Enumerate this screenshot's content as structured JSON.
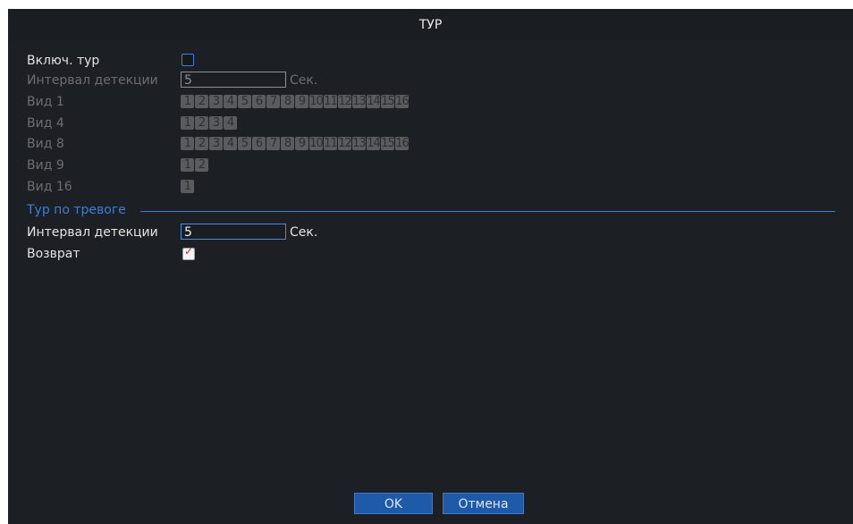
{
  "dialog": {
    "title": "ТУР"
  },
  "enable_tour": {
    "label": "Включ. тур",
    "checked": false
  },
  "detect_interval": {
    "label": "Интервал детекции",
    "value": "5",
    "unit": "Сек."
  },
  "views": [
    {
      "label": "Вид 1",
      "tiles": [
        "1",
        "2",
        "3",
        "4",
        "5",
        "6",
        "7",
        "8",
        "9",
        "10",
        "11",
        "12",
        "13",
        "14",
        "15",
        "16"
      ]
    },
    {
      "label": "Вид 4",
      "tiles": [
        "1",
        "2",
        "3",
        "4"
      ]
    },
    {
      "label": "Вид 8",
      "tiles": [
        "1",
        "2",
        "3",
        "4",
        "5",
        "6",
        "7",
        "8",
        "9",
        "10",
        "11",
        "12",
        "13",
        "14",
        "15",
        "16"
      ]
    },
    {
      "label": "Вид 9",
      "tiles": [
        "1",
        "2"
      ]
    },
    {
      "label": "Вид 16",
      "tiles": [
        "1"
      ]
    }
  ],
  "alarm_tour": {
    "section_label": "Тур по тревоге",
    "interval_label": "Интервал детекции",
    "interval_value": "5",
    "interval_unit": "Сек.",
    "return_label": "Возврат",
    "return_checked": true
  },
  "buttons": {
    "ok": "OK",
    "cancel": "Отмена"
  },
  "colors": {
    "accent": "#3a7fd0",
    "button": "#1e5aa8",
    "background": "#1c1f24"
  }
}
